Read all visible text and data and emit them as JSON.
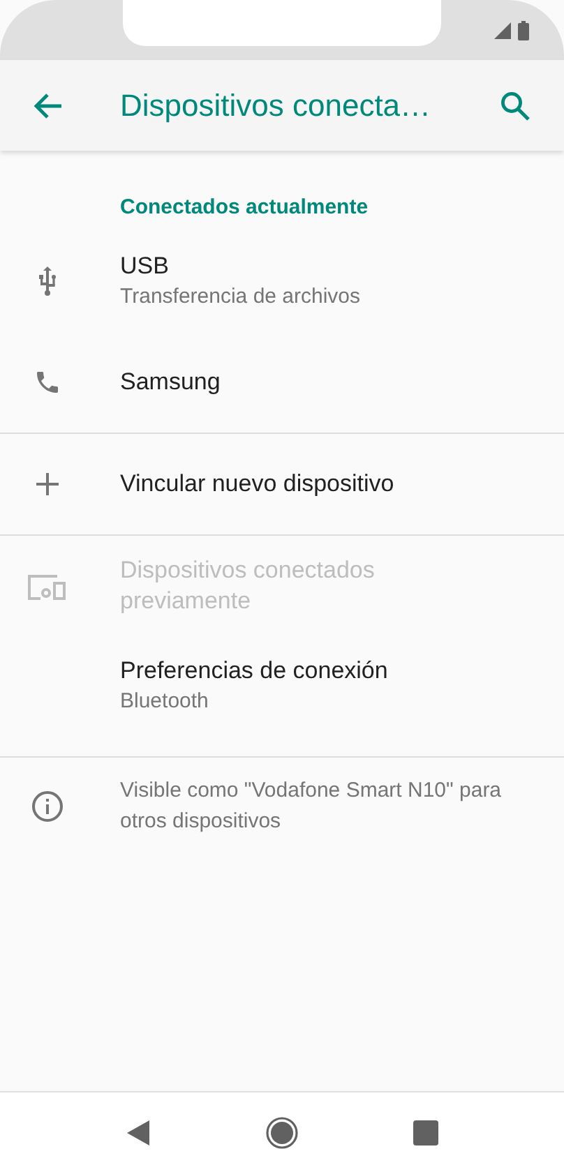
{
  "app_bar": {
    "title": "Dispositivos conecta…"
  },
  "groups": [
    {
      "header": "Conectados actualmente",
      "items": [
        {
          "title": "USB",
          "subtitle": "Transferencia de archivos",
          "disabled": false
        },
        {
          "title": "Samsung",
          "disabled": false
        }
      ]
    },
    {
      "items": [
        {
          "title": "Vincular nuevo dispositivo",
          "disabled": false
        }
      ]
    },
    {
      "items": [
        {
          "title": "Dispositivos conectados previamente",
          "disabled": true
        },
        {
          "title": "Preferencias de conexión",
          "subtitle": "Bluetooth",
          "disabled": false
        }
      ]
    },
    {
      "items": [
        {
          "kind": "info",
          "title": "Visible como \"Vodafone Smart N10\" para otros dispositivos"
        }
      ]
    }
  ]
}
